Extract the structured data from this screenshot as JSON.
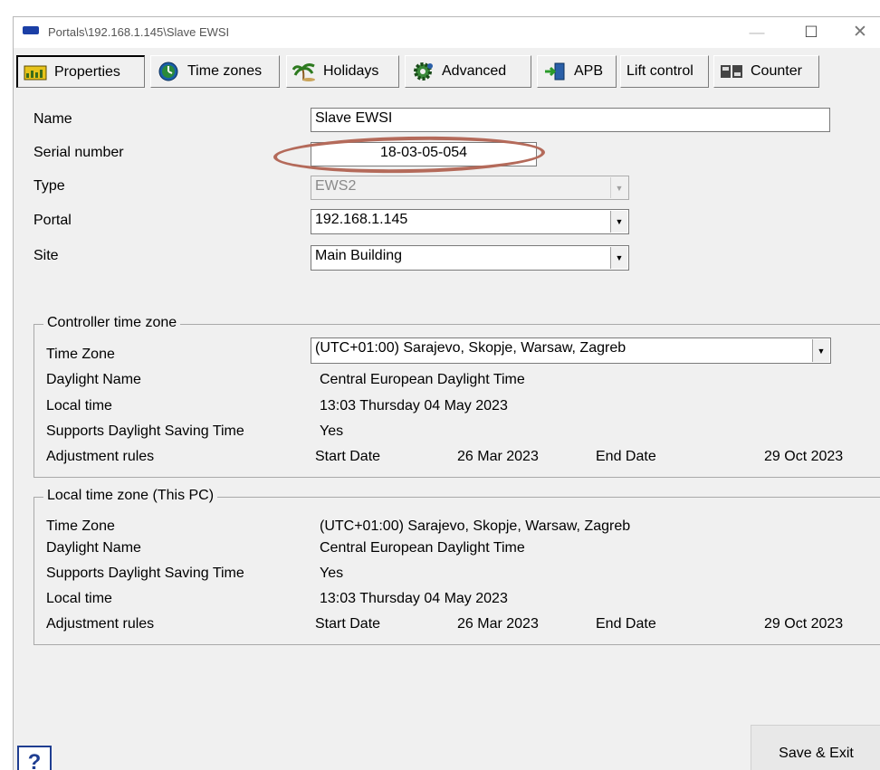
{
  "window": {
    "title": "Portals\\192.168.1.145\\Slave EWSI",
    "controls": {
      "minimize": "—",
      "maximize": "☐",
      "close": "✕"
    }
  },
  "tabs": [
    {
      "label": "Properties",
      "icon": "properties-icon",
      "active": true
    },
    {
      "label": "Time zones",
      "icon": "clock-icon"
    },
    {
      "label": "Holidays",
      "icon": "palm-tree-icon"
    },
    {
      "label": "Advanced",
      "icon": "gear-icon"
    },
    {
      "label": "APB",
      "icon": "door-arrow-icon"
    },
    {
      "label": "Lift control",
      "icon": ""
    },
    {
      "label": "Counter",
      "icon": "counter-icon"
    }
  ],
  "properties": {
    "name_label": "Name",
    "name_value": "Slave EWSI",
    "serial_label": "Serial number",
    "serial_value": "18-03-05-054",
    "type_label": "Type",
    "type_value": "EWS2",
    "portal_label": "Portal",
    "portal_value": "192.168.1.145",
    "site_label": "Site",
    "site_value": "Main Building"
  },
  "controller_tz": {
    "title": "Controller time zone",
    "tz_label": "Time Zone",
    "tz_value": "(UTC+01:00) Sarajevo, Skopje, Warsaw, Zagreb",
    "daylight_label": "Daylight Name",
    "daylight_value": "Central European Daylight Time",
    "local_label": "Local time",
    "local_value": "13:03  Thursday 04 May 2023",
    "dst_label": "Supports Daylight Saving Time",
    "dst_value": "Yes",
    "rules_label": "Adjustment rules",
    "start_label": "Start Date",
    "start_value": "26 Mar 2023",
    "end_label": "End Date",
    "end_value": "29 Oct 2023"
  },
  "local_tz": {
    "title": "Local time zone (This PC)",
    "tz_label": "Time Zone",
    "tz_value": "(UTC+01:00) Sarajevo, Skopje, Warsaw, Zagreb",
    "daylight_label": "Daylight Name",
    "daylight_value": "Central European Daylight Time",
    "dst_label": "Supports Daylight Saving Time",
    "dst_value": "Yes",
    "local_label": "Local time",
    "local_value": "13:03  Thursday 04 May 2023",
    "rules_label": "Adjustment rules",
    "start_label": "Start Date",
    "start_value": "26 Mar 2023",
    "end_label": "End Date",
    "end_value": "29 Oct 2023"
  },
  "footer": {
    "help_label": "?",
    "save_label": "Save & Exit"
  },
  "colors": {
    "accent": "#1f3e91",
    "highlight_oval": "#b46a5a",
    "window_bg": "#f0f0f0"
  }
}
